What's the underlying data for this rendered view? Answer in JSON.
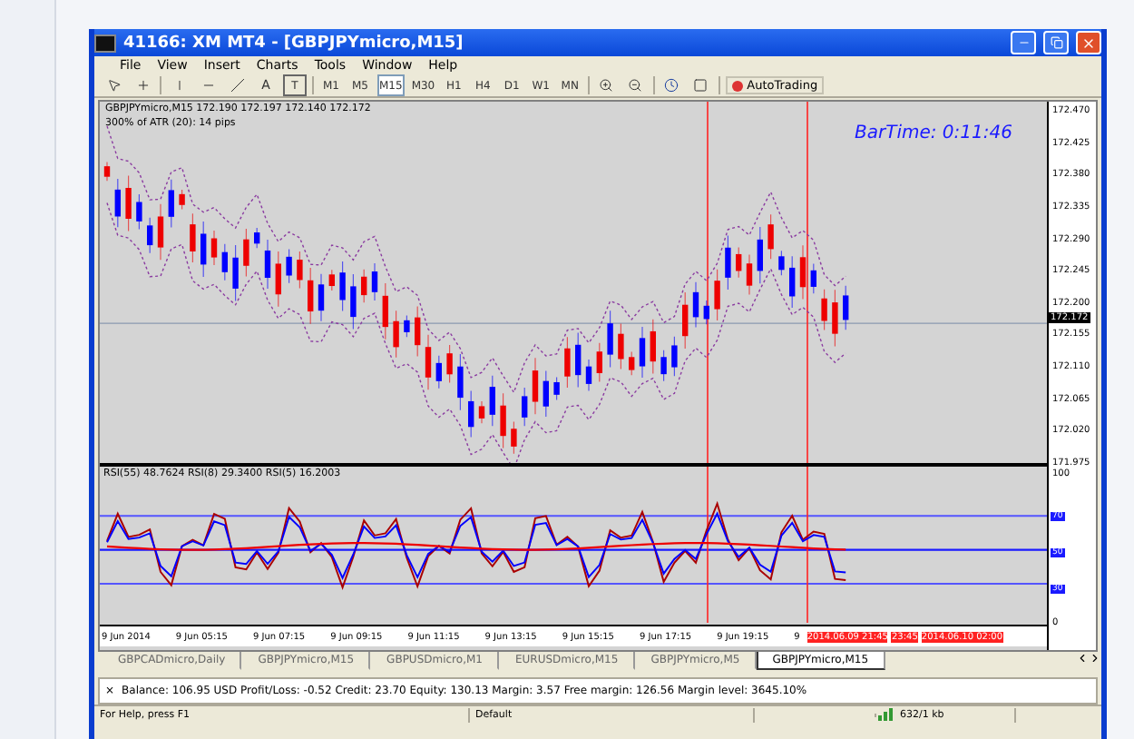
{
  "window": {
    "title": "41166: XM MT4 - [GBPJPYmicro,M15]"
  },
  "menu": [
    "File",
    "View",
    "Insert",
    "Charts",
    "Tools",
    "Window",
    "Help"
  ],
  "toolbar": {
    "text_tool": "A",
    "label_tool": "T",
    "timeframes": [
      {
        "label": "M1",
        "selected": false
      },
      {
        "label": "M5",
        "selected": false
      },
      {
        "label": "M15",
        "selected": true
      },
      {
        "label": "M30",
        "selected": false
      },
      {
        "label": "H1",
        "selected": false
      },
      {
        "label": "H4",
        "selected": false
      },
      {
        "label": "D1",
        "selected": false
      },
      {
        "label": "W1",
        "selected": false
      },
      {
        "label": "MN",
        "selected": false
      }
    ],
    "autotrading": "AutoTrading"
  },
  "chart": {
    "header": "GBPJPYmicro,M15  172.190 172.197 172.140 172.172",
    "atr": "300% of ATR (20):   14 pips",
    "bartime": "BarTime:   0:11:46",
    "price_ticks": [
      "172.470",
      "172.425",
      "172.380",
      "172.335",
      "172.290",
      "172.245",
      "172.200",
      "172.155",
      "172.110",
      "172.065",
      "172.020",
      "171.975"
    ],
    "current_price": "172.172",
    "rsi_header": "RSI(55) 48.7624  RSI(8) 29.3400  RSI(5) 16.2003",
    "rsi_ticks": [
      "100",
      "0"
    ],
    "rsi_levels": [
      "70",
      "50",
      "30"
    ],
    "time_ticks": [
      "9 Jun 2014",
      "9 Jun 05:15",
      "9 Jun 07:15",
      "9 Jun 09:15",
      "9 Jun 11:15",
      "9 Jun 13:15",
      "9 Jun 15:15",
      "9 Jun 17:15",
      "9 Jun 19:15",
      "9"
    ],
    "time_markers": [
      "2014.06.09 21:45",
      "23:45",
      "2014.06.10 02:00"
    ]
  },
  "tabs": [
    {
      "label": "GBPCADmicro,Daily",
      "selected": false
    },
    {
      "label": "GBPJPYmicro,M15",
      "selected": false
    },
    {
      "label": "GBPUSDmicro,M1",
      "selected": false
    },
    {
      "label": "EURUSDmicro,M15",
      "selected": false
    },
    {
      "label": "GBPJPYmicro,M5",
      "selected": false
    },
    {
      "label": "GBPJPYmicro,M15",
      "selected": true
    }
  ],
  "terminal": {
    "close": "×",
    "summary": "Balance: 106.95 USD  Profit/Loss: -0.52  Credit: 23.70  Equity: 130.13  Margin: 3.57  Free margin: 126.56  Margin level: 3645.10%"
  },
  "status_bar": {
    "help": "For Help, press F1",
    "profile": "Default",
    "traffic": "632/1 kb"
  }
}
